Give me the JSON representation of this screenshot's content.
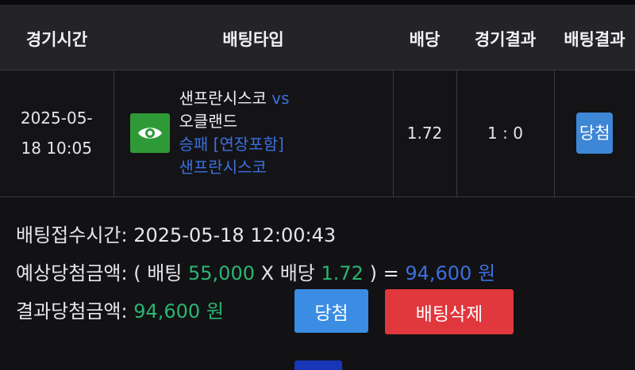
{
  "headers": {
    "time": "경기시간",
    "type": "배팅타입",
    "odds": "배당",
    "game_result": "경기결과",
    "bet_result": "배팅결과"
  },
  "row": {
    "time_line1": "2025-05-",
    "time_line2": "18 10:05",
    "home_team": "샌프란시스코",
    "vs": "vs",
    "away_team": "오클랜드",
    "bet_kind": "승패 [연장포함]",
    "bet_pick": "샌프란시스코",
    "odds": "1.72",
    "score": "1 : 0",
    "status": "당첨",
    "icon": "eye-icon"
  },
  "summary": {
    "bet_time_label": "배팅접수시간:",
    "bet_time_value": "2025-05-18 12:00:43",
    "expected_label": "예상당첨금액:",
    "expected_open": "( 배팅",
    "expected_stake": "55,000",
    "expected_x": "X 배당",
    "expected_odds": "1.72",
    "expected_close": ") =",
    "expected_amount": "94,600 원",
    "result_label": "결과당첨금액:",
    "result_amount": "94,600 원"
  },
  "buttons": {
    "win": "당첨",
    "delete": "배팅삭제"
  },
  "colors": {
    "accent_blue": "#3b6fe0",
    "accent_green": "#2bb573",
    "badge_blue": "#3e86d6",
    "delete_red": "#e0383d",
    "eye_green": "#2e9a37"
  }
}
